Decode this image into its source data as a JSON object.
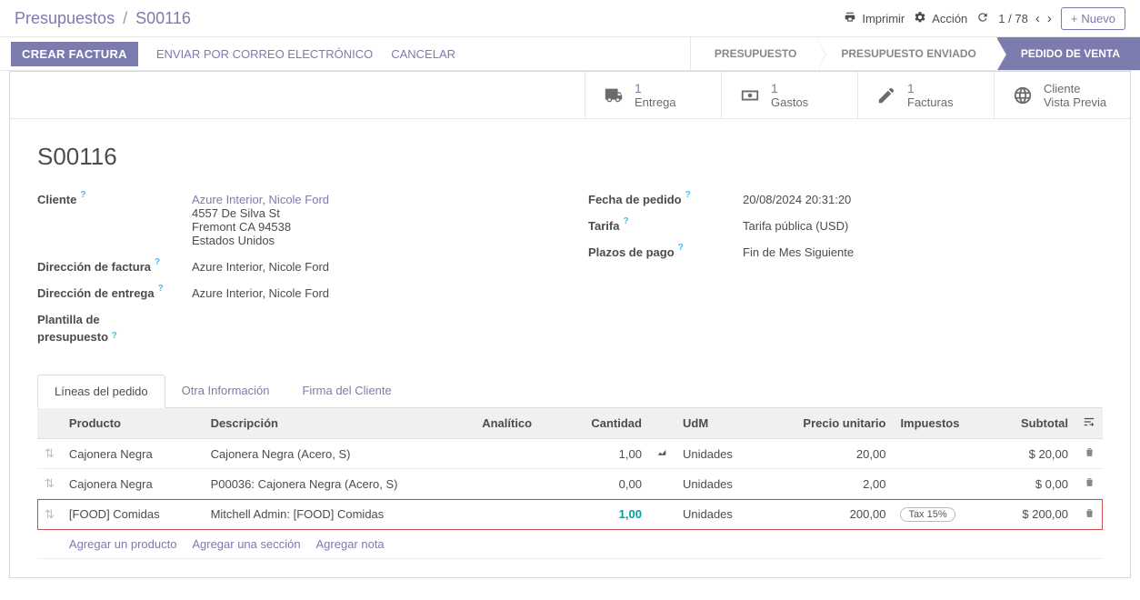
{
  "breadcrumb": {
    "root": "Presupuestos",
    "leaf": "S00116"
  },
  "topbar": {
    "print": "Imprimir",
    "action": "Acción",
    "pager_value": "1 / 78",
    "new": "Nuevo"
  },
  "actionbar": {
    "create_invoice": "CREAR FACTURA",
    "send_by_email": "ENVIAR POR CORREO ELECTRÓNICO",
    "cancel": "CANCELAR"
  },
  "status": {
    "step0": "PRESUPUESTO",
    "step1": "PRESUPUESTO ENVIADO",
    "step2": "PEDIDO DE VENTA"
  },
  "stats": {
    "delivery": {
      "count": "1",
      "label": "Entrega"
    },
    "expenses": {
      "count": "1",
      "label": "Gastos"
    },
    "invoices": {
      "count": "1",
      "label": "Facturas"
    },
    "preview": {
      "line1": "Cliente",
      "line2": "Vista Previa"
    }
  },
  "doc_title": "S00116",
  "fields_left": {
    "cliente_label": "Cliente",
    "cliente_name": "Azure Interior, Nicole Ford",
    "cliente_addr1": "4557 De Silva St",
    "cliente_addr2": "Fremont CA 94538",
    "cliente_addr3": "Estados Unidos",
    "factura_label": "Dirección de factura",
    "factura_value": "Azure Interior, Nicole Ford",
    "entrega_label": "Dirección de entrega",
    "entrega_value": "Azure Interior, Nicole Ford",
    "plantilla_label_l1": "Plantilla de",
    "plantilla_label_l2": "presupuesto"
  },
  "fields_right": {
    "fecha_label": "Fecha de pedido",
    "fecha_value": "20/08/2024 20:31:20",
    "tarifa_label": "Tarifa",
    "tarifa_value": "Tarifa pública (USD)",
    "plazos_label": "Plazos de pago",
    "plazos_value": "Fin de Mes Siguiente"
  },
  "tabs": {
    "t0": "Líneas del pedido",
    "t1": "Otra Información",
    "t2": "Firma del Cliente"
  },
  "table": {
    "headers": {
      "producto": "Producto",
      "descripcion": "Descripción",
      "analitico": "Analítico",
      "cantidad": "Cantidad",
      "udm": "UdM",
      "precio": "Precio unitario",
      "impuestos": "Impuestos",
      "subtotal": "Subtotal"
    },
    "rows": [
      {
        "producto": "Cajonera Negra",
        "descripcion": "Cajonera Negra (Acero, S)",
        "cantidad": "1,00",
        "udm": "Unidades",
        "precio": "20,00",
        "impuestos": "",
        "subtotal": "$ 20,00"
      },
      {
        "producto": "Cajonera Negra",
        "descripcion": "P00036: Cajonera Negra (Acero, S)",
        "cantidad": "0,00",
        "udm": "Unidades",
        "precio": "2,00",
        "impuestos": "",
        "subtotal": "$ 0,00"
      },
      {
        "producto": "[FOOD] Comidas",
        "descripcion": "Mitchell Admin: [FOOD] Comidas",
        "cantidad": "1,00",
        "udm": "Unidades",
        "precio": "200,00",
        "impuestos": "Tax 15%",
        "subtotal": "$ 200,00"
      }
    ]
  },
  "add_links": {
    "a0": "Agregar un producto",
    "a1": "Agregar una sección",
    "a2": "Agregar nota"
  }
}
